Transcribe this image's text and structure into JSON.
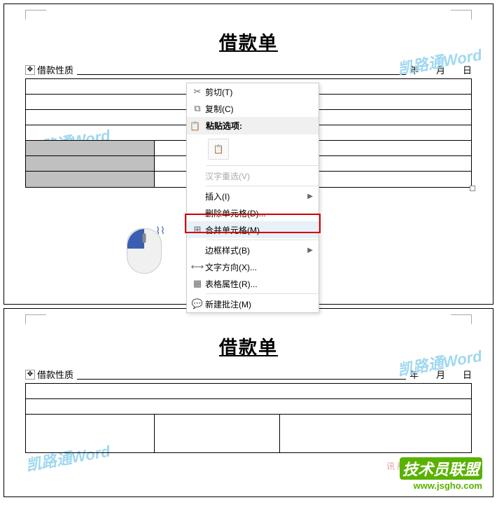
{
  "doc": {
    "title": "借款单",
    "nature_label": "借款性质",
    "year": "年",
    "month": "月",
    "day": "日"
  },
  "menu": {
    "cut": "剪切(T)",
    "copy": "复制(C)",
    "paste_header": "粘贴选项:",
    "hanzi": "汉字重选(V)",
    "insert": "插入(I)",
    "delete_cells": "删除单元格(D)...",
    "merge_cells": "合并单元格(M)",
    "border_style": "边框样式(B)",
    "text_direction": "文字方向(X)...",
    "table_props": "表格属性(R)...",
    "new_comment": "新建批注(M)"
  },
  "watermark": "凯路通Word",
  "logo": {
    "main": "技术员联盟",
    "url": "www.jsgho.com",
    "overlay": "讯系统教程学习网"
  }
}
